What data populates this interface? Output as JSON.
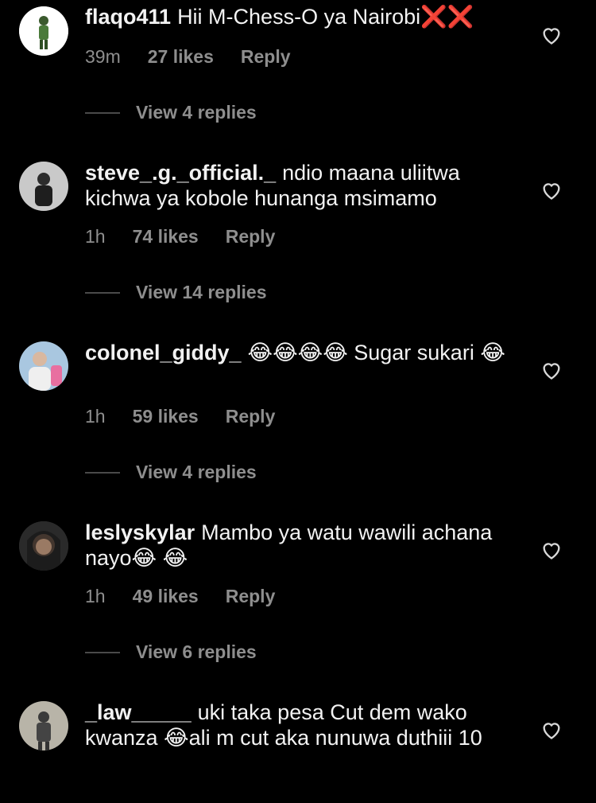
{
  "comments": [
    {
      "username": "flaqo411",
      "text": "Hii M-Chess-O ya Nairobi❌❌",
      "time": "39m",
      "likes": "27 likes",
      "reply": "Reply",
      "view_replies": "View 4 replies"
    },
    {
      "username": "steve_.g._official._",
      "text": "ndio maana uliitwa kichwa ya kobole hunanga msimamo",
      "time": "1h",
      "likes": "74 likes",
      "reply": "Reply",
      "view_replies": "View 14 replies"
    },
    {
      "username": "colonel_giddy_",
      "text": "😂😂😂😂 Sugar sukari 😂",
      "time": "1h",
      "likes": "59 likes",
      "reply": "Reply",
      "view_replies": "View 4 replies"
    },
    {
      "username": "leslyskylar",
      "text": "Mambo ya watu wawili achana nayo😂 😂",
      "time": "1h",
      "likes": "49 likes",
      "reply": "Reply",
      "view_replies": "View 6 replies"
    },
    {
      "username": "_law_____",
      "text": "uki taka pesa Cut dem wako kwanza 😂ali m cut aka nunuwa duthiii 10"
    }
  ],
  "icons": {
    "like": "heart-outline-icon"
  },
  "colors": {
    "background": "#000000",
    "text": "#f5f5f5",
    "meta": "#8e8e8e"
  }
}
